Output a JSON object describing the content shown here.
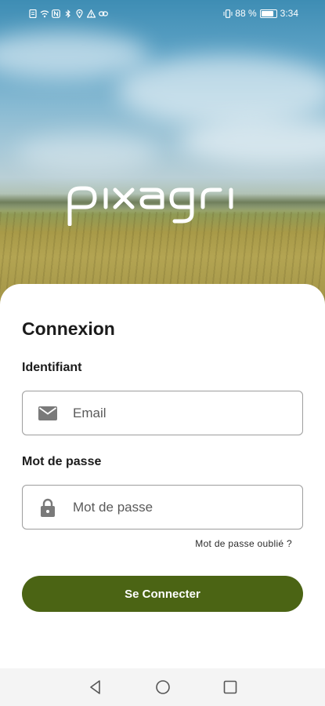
{
  "status_bar": {
    "battery_percent": "88 %",
    "battery_level": 0.88,
    "time": "3:34",
    "left_icons": [
      "file-icon",
      "wifi-icon",
      "nfc-icon",
      "bluetooth-icon",
      "location-icon",
      "warning-icon",
      "link-icon"
    ],
    "right_icons": [
      "vibrate-icon",
      "battery-icon"
    ]
  },
  "hero": {
    "brand_logo_text": "pixagri"
  },
  "login": {
    "title": "Connexion",
    "username_label": "Identifiant",
    "username_placeholder": "Email",
    "username_icon": "envelope-icon",
    "password_label": "Mot de passe",
    "password_placeholder": "Mot de passe",
    "password_icon": "lock-icon",
    "forgot_password": "Mot de passe oublié ?",
    "submit_label": "Se Connecter"
  },
  "nav_bar": {
    "items": [
      "back-icon",
      "home-icon",
      "recents-icon"
    ]
  },
  "colors": {
    "accent": "#4b6414",
    "field_border": "#9d9d9d",
    "icon_gray": "#7a7a7a"
  }
}
